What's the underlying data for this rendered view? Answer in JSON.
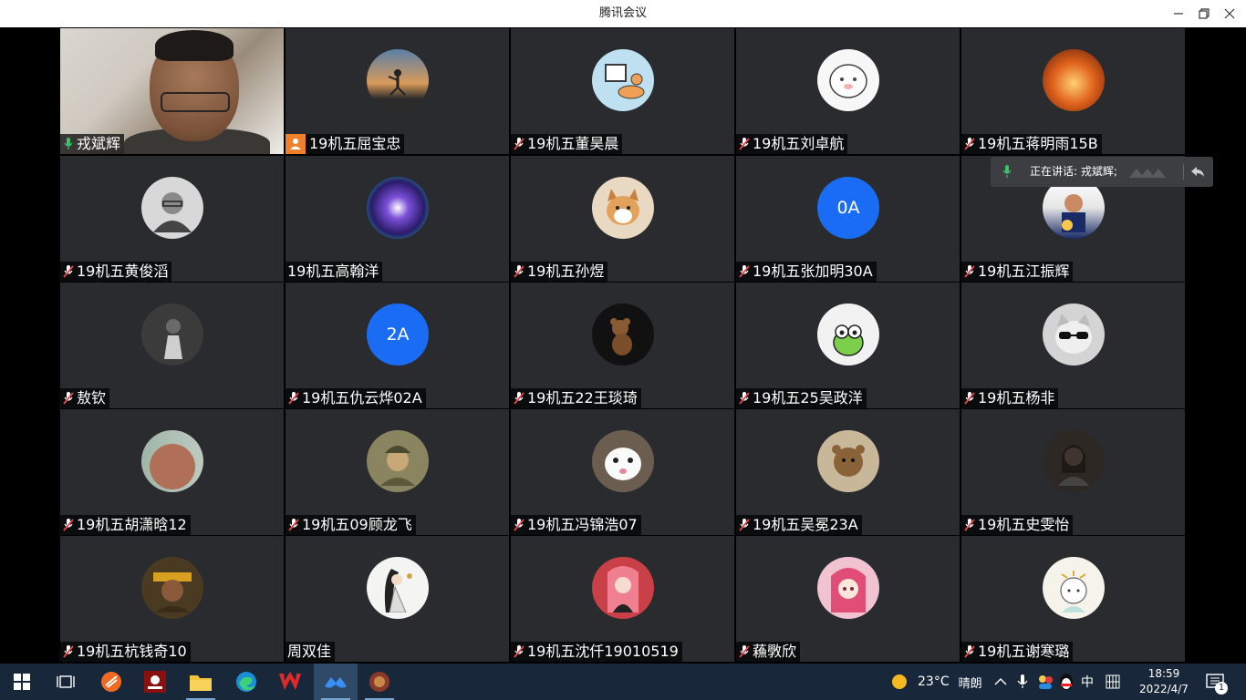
{
  "window": {
    "title": "腾讯会议"
  },
  "participants": [
    {
      "name": "戎斌辉"
    },
    {
      "name": "19机五屈宝忠"
    },
    {
      "name": "19机五董昊晨"
    },
    {
      "name": "19机五刘卓航"
    },
    {
      "name": "19机五蒋明雨15B"
    },
    {
      "name": "19机五黄俊滔"
    },
    {
      "name": "19机五高翰洋"
    },
    {
      "name": "19机五孙煜"
    },
    {
      "name": "19机五张加明30A",
      "avatar_text": "0A"
    },
    {
      "name": "19机五江振辉"
    },
    {
      "name": "敖钦"
    },
    {
      "name": "19机五仇云烨02A",
      "avatar_text": "2A"
    },
    {
      "name": "19机五22王琰琦"
    },
    {
      "name": "19机五25吴政洋"
    },
    {
      "name": "19机五杨非"
    },
    {
      "name": "19机五胡潇晗12"
    },
    {
      "name": "19机五09顾龙飞"
    },
    {
      "name": "19机五冯锦浩07"
    },
    {
      "name": "19机五吴冕23A"
    },
    {
      "name": "19机五史雯怡"
    },
    {
      "name": "19机五杭钱奇10"
    },
    {
      "name": "周双佳"
    },
    {
      "name": "19机五沈仟19010519"
    },
    {
      "name": "蘓斆欣"
    },
    {
      "name": "19机五谢寒璐"
    }
  ],
  "speaking": {
    "text": "正在讲话: 戎斌辉;"
  },
  "tray": {
    "temperature": "23°C",
    "weather": "晴朗",
    "ime": "中",
    "time": "18:59",
    "date": "2022/4/7",
    "notifications": "1"
  },
  "colors": {
    "accent_blue": "#1a6cf5",
    "active_green": "#3cc36a",
    "mic_muted_red": "#e5484d",
    "taskbar": "#18283a"
  }
}
